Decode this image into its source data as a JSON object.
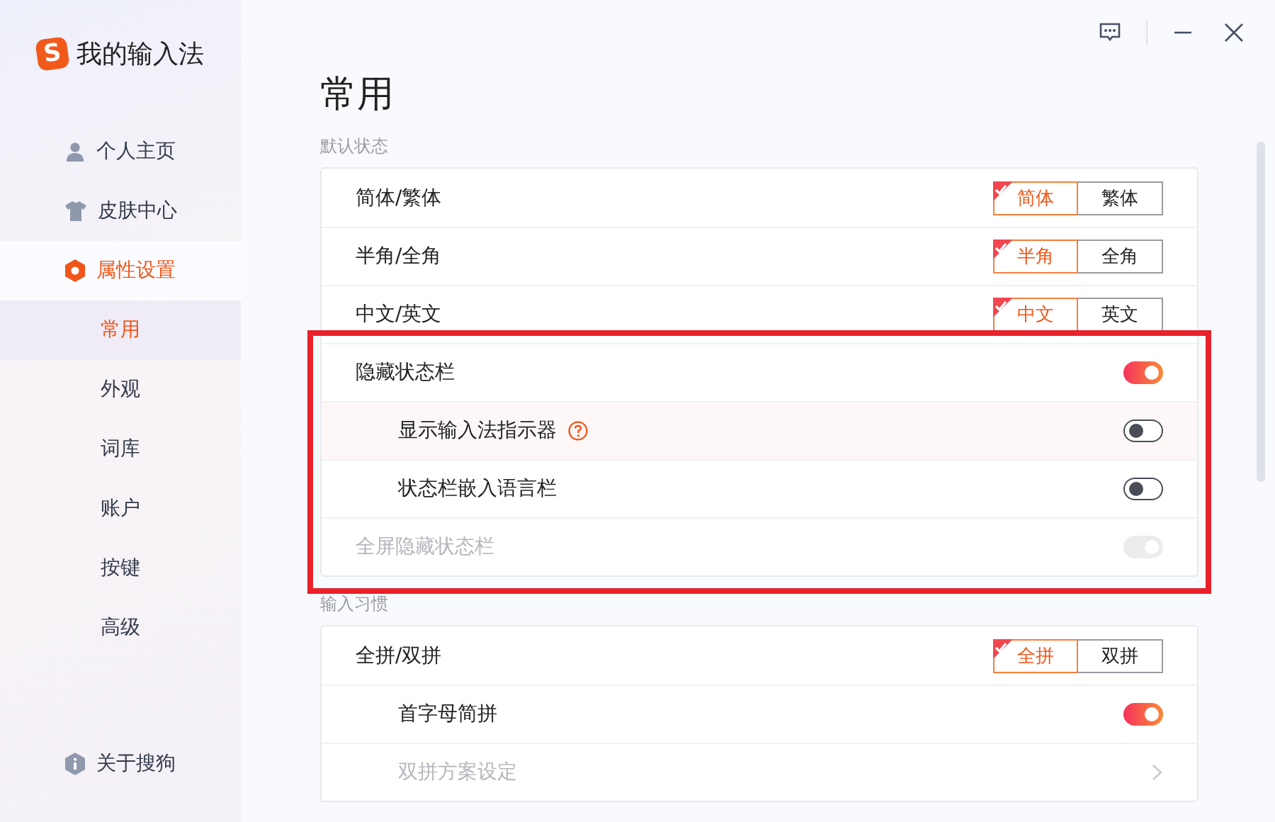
{
  "app": {
    "logo_letter": "S",
    "title": "我的输入法"
  },
  "window_controls": [
    {
      "kind": "feedback"
    },
    {
      "kind": "minimize"
    },
    {
      "kind": "close"
    }
  ],
  "sidebar": {
    "items": [
      {
        "label": "个人主页",
        "kind": "person",
        "selected": false
      },
      {
        "label": "皮肤中心",
        "kind": "shirt",
        "selected": false
      },
      {
        "label": "属性设置",
        "kind": "hexagon",
        "selected": true,
        "children": [
          {
            "label": "常用",
            "selected": true
          },
          {
            "label": "外观",
            "selected": false
          },
          {
            "label": "词库",
            "selected": false
          },
          {
            "label": "账户",
            "selected": false
          },
          {
            "label": "按键",
            "selected": false
          },
          {
            "label": "高级",
            "selected": false
          }
        ]
      }
    ],
    "footer": {
      "label": "关于搜狗",
      "kind": "info"
    }
  },
  "page_title": "常用",
  "sections": [
    {
      "title": "默认状态",
      "blocks": [
        {
          "highlighted": false,
          "rows": [
            {
              "kind": "segment",
              "label": "简体/繁体",
              "options": [
                {
                  "label": "简体",
                  "selected": true
                },
                {
                  "label": "繁体",
                  "selected": false
                }
              ]
            },
            {
              "kind": "segment",
              "label": "半角/全角",
              "options": [
                {
                  "label": "半角",
                  "selected": true
                },
                {
                  "label": "全角",
                  "selected": false
                }
              ]
            },
            {
              "kind": "segment",
              "label": "中文/英文",
              "options": [
                {
                  "label": "中文",
                  "selected": true
                },
                {
                  "label": "英文",
                  "selected": false
                }
              ]
            }
          ]
        },
        {
          "highlighted": true,
          "rows": [
            {
              "kind": "toggle",
              "label": "隐藏状态栏",
              "on": true,
              "disabled": false,
              "children": [
                {
                  "kind": "toggle",
                  "label": "显示输入法指示器",
                  "on": false,
                  "disabled": false,
                  "help": true,
                  "hovered": true
                },
                {
                  "kind": "toggle",
                  "label": "状态栏嵌入语言栏",
                  "on": false,
                  "disabled": false
                }
              ]
            },
            {
              "kind": "toggle",
              "label": "全屏隐藏状态栏",
              "on": true,
              "disabled": true
            }
          ]
        }
      ]
    },
    {
      "title": "输入习惯",
      "blocks": [
        {
          "highlighted": false,
          "rows": [
            {
              "kind": "segment",
              "label": "全拼/双拼",
              "options": [
                {
                  "label": "全拼",
                  "selected": true
                },
                {
                  "label": "双拼",
                  "selected": false
                }
              ],
              "children": [
                {
                  "kind": "toggle",
                  "label": "首字母简拼",
                  "on": true,
                  "disabled": false
                },
                {
                  "kind": "link",
                  "label": "双拼方案设定",
                  "disabled": true
                }
              ]
            }
          ]
        }
      ]
    }
  ]
}
